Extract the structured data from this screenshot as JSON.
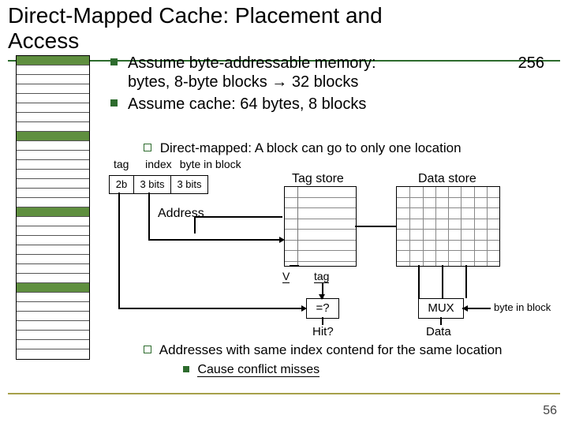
{
  "title_line1": "Direct-Mapped Cache: Placement and",
  "title_line2": "Access",
  "bullets": {
    "b1a": "Assume byte-addressable memory:",
    "b1b": "256",
    "b1c": "bytes, 8-byte blocks → 32 blocks",
    "b2": "Assume cache: 64 bytes, 8 blocks"
  },
  "sub1": "Direct-mapped: A block can go to only one location",
  "addr": {
    "tag": "tag",
    "index": "index",
    "byte": "byte in block",
    "c_tag": "2b",
    "c_index": "3 bits",
    "c_byte": "3 bits"
  },
  "labels": {
    "address": "Address",
    "tagstore": "Tag store",
    "datastore": "Data store",
    "v": "V",
    "tag": "tag",
    "cmp": "=?",
    "mux": "MUX",
    "hit": "Hit?",
    "data": "Data",
    "bib": "byte in block"
  },
  "note": "Addresses with same index contend for the same location",
  "subnote": "Cause conflict misses",
  "memrows": 32,
  "highlight_rows": [
    0,
    8,
    16,
    24
  ],
  "store_rows": 8,
  "pagenum": "56"
}
